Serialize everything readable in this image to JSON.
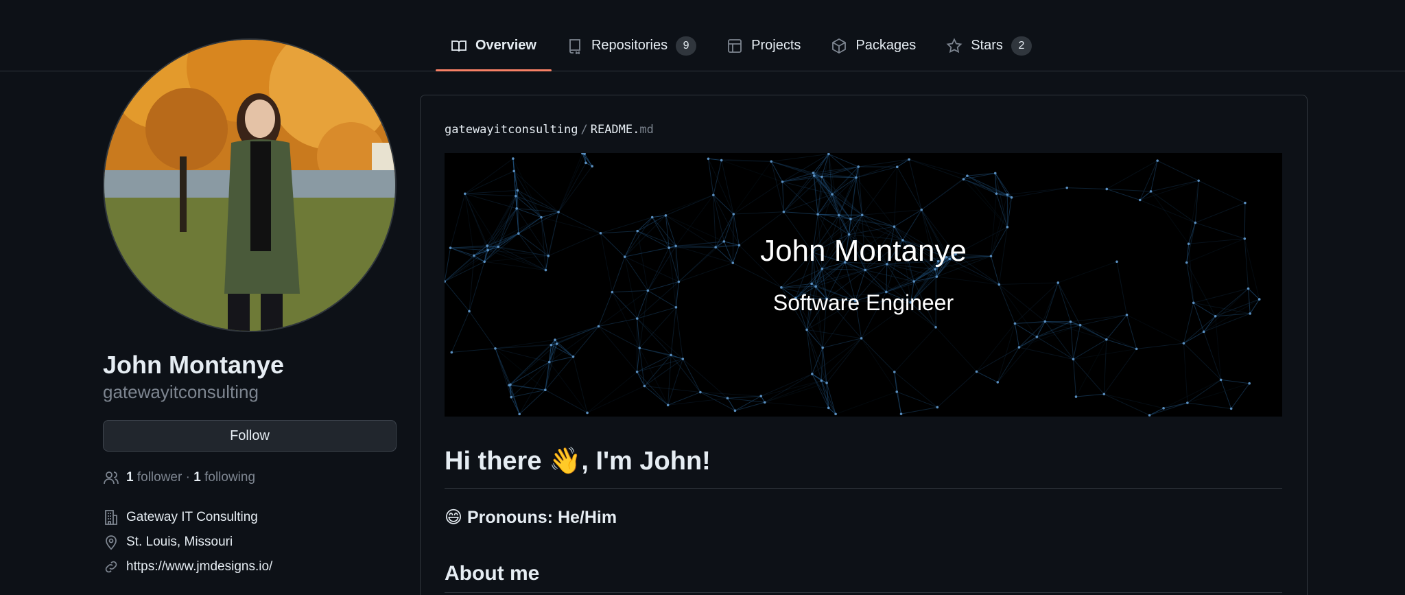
{
  "nav": {
    "tabs": [
      {
        "label": "Overview",
        "icon": "book-icon",
        "active": true
      },
      {
        "label": "Repositories",
        "icon": "repo-icon",
        "count": "9"
      },
      {
        "label": "Projects",
        "icon": "table-icon"
      },
      {
        "label": "Packages",
        "icon": "package-icon"
      },
      {
        "label": "Stars",
        "icon": "star-icon",
        "count": "2"
      }
    ]
  },
  "profile": {
    "fullname": "John Montanye",
    "username": "gatewayitconsulting",
    "follow_label": "Follow",
    "followers_count": "1",
    "followers_label": "follower",
    "separator": "·",
    "following_count": "1",
    "following_label": "following",
    "company": "Gateway IT Consulting",
    "location": "St. Louis, Missouri",
    "website": "https://www.jmdesigns.io/"
  },
  "readme": {
    "owner": "gatewayitconsulting",
    "sep": "/",
    "file_base": "README.",
    "file_ext": "md",
    "banner_title": "John Montanye",
    "banner_subtitle": "Software Engineer",
    "heading": "Hi there 👋, I'm John!",
    "pronouns": "😄 Pronouns: He/Him",
    "about": "About me"
  },
  "colors": {
    "background": "#0d1117",
    "border": "#30363d",
    "accent_underline": "#f78166",
    "muted_text": "#7d8590"
  }
}
